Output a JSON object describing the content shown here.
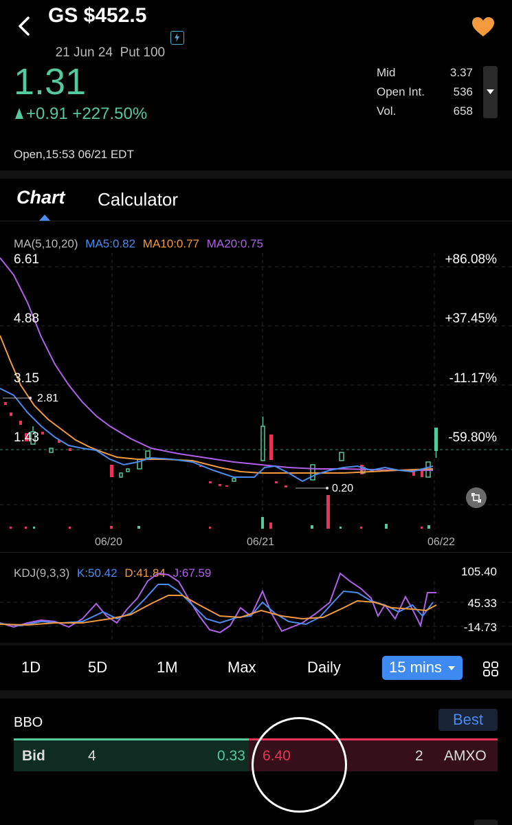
{
  "header": {
    "title": "GS $452.5",
    "subtitle": "21 Jun 24  Put 100"
  },
  "quote": {
    "price": "1.31",
    "change": "+0.91",
    "change_pct": "+227.50%",
    "stats": [
      {
        "label": "Mid",
        "value": "3.37"
      },
      {
        "label": "Open Int.",
        "value": "536"
      },
      {
        "label": "Vol.",
        "value": "658"
      }
    ],
    "status": "Open,15:53 06/21 EDT"
  },
  "tabs": {
    "chart": "Chart",
    "calculator": "Calculator"
  },
  "main_chart": {
    "indicator": "MA(5,10,20)",
    "ma5": "MA5:0.82",
    "ma10": "MA10:0.77",
    "ma20": "MA20:0.75",
    "price_labels": [
      "6.61",
      "4.88",
      "3.15",
      "1.43"
    ],
    "pct_labels": [
      "+86.08%",
      "+37.45%",
      "-11.17%",
      "-59.80%"
    ],
    "high_marker": "2.81",
    "low_marker": "0.20",
    "dates": [
      "06/20",
      "06/21",
      "06/22"
    ]
  },
  "kdj_chart": {
    "indicator": "KDJ(9,3,3)",
    "k": "K:50.42",
    "d": "D:41.84",
    "j": "J:67.59",
    "levels": [
      "105.40",
      "45.33",
      "-14.73"
    ]
  },
  "periods": {
    "p1": "1D",
    "p2": "5D",
    "p3": "1M",
    "p4": "Max",
    "p5": "Daily",
    "selected": "15 mins"
  },
  "bbo": {
    "title": "BBO",
    "best_label": "Best",
    "bid_label": "Bid",
    "bid_size": "4",
    "bid_price": "0.33",
    "ask_price": "6.40",
    "ask_size": "2",
    "exchange": "AMXO"
  },
  "colors": {
    "up": "#54c99c",
    "down": "#e8345a",
    "ma5": "#4a8cf0",
    "ma10": "#f39a3d",
    "ma20": "#b061ea",
    "favorite": "#f39a3d"
  }
}
